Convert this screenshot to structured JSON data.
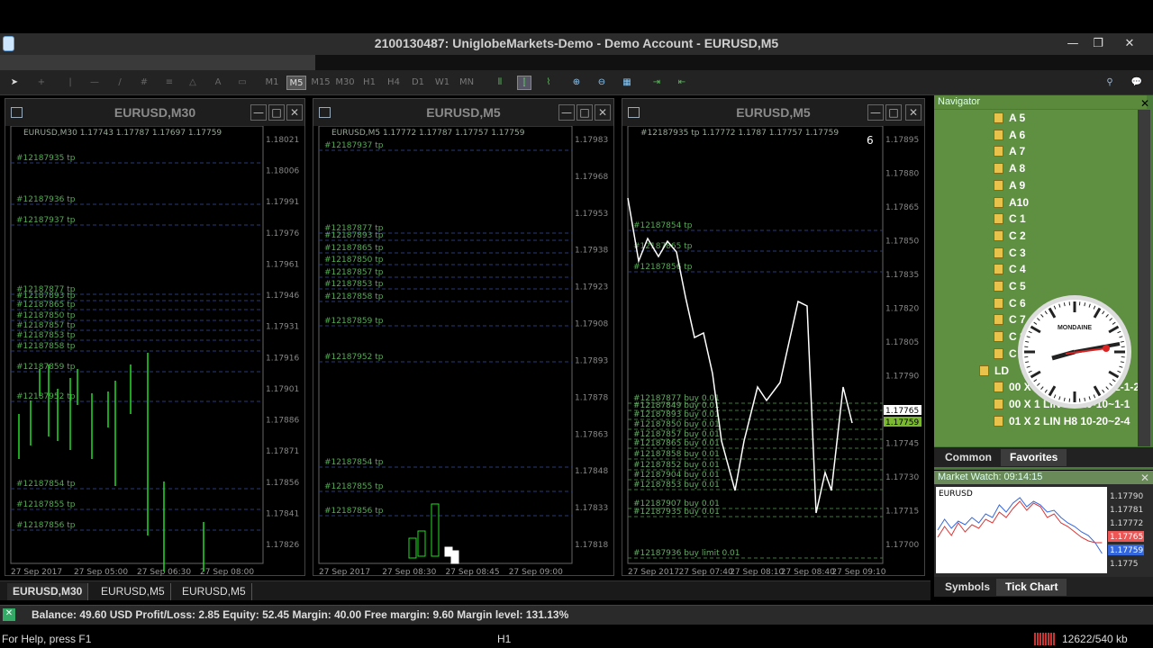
{
  "window": {
    "title": "2100130487: UniglobeMarkets-Demo - Demo Account - EURUSD,M5",
    "minimize": "—",
    "restore": "❐",
    "close": "✕"
  },
  "toolbar": {
    "timeframes": [
      "M1",
      "M5",
      "M15",
      "M30",
      "H1",
      "H4",
      "D1",
      "W1",
      "MN"
    ],
    "active_timeframe": "M5"
  },
  "charts": [
    {
      "title": "EURUSD,M30",
      "header": "EURUSD,M30  1.17743 1.17787 1.17697 1.17759",
      "prices": [
        "1.18021",
        "1.18006",
        "1.17991",
        "1.17976",
        "1.17961",
        "1.17946",
        "1.17931",
        "1.17916",
        "1.17901",
        "1.17886",
        "1.17871",
        "1.17856",
        "1.17841",
        "1.17826"
      ],
      "times": [
        "27 Sep 2017",
        "27 Sep 05:00",
        "27 Sep 06:30",
        "27 Sep 08:00"
      ],
      "orders": [
        "#12187935 tp",
        "#12187936 tp",
        "#12187937 tp",
        "#12187877 tp",
        "#12187893 tp",
        "#12187865 tp",
        "#12187850 tp",
        "#12187857 tp",
        "#12187853 tp",
        "#12187858 tp",
        "#12187859 tp",
        "#12187952 tp",
        "#12187854 tp",
        "#12187855 tp",
        "#12187856 tp"
      ]
    },
    {
      "title": "EURUSD,M5",
      "header": "EURUSD,M5  1.17772 1.17787 1.17757 1.17759",
      "prices": [
        "1.17983",
        "1.17968",
        "1.17953",
        "1.17938",
        "1.17923",
        "1.17908",
        "1.17893",
        "1.17878",
        "1.17863",
        "1.17848",
        "1.17833",
        "1.17818"
      ],
      "times": [
        "27 Sep 2017",
        "27 Sep 08:30",
        "27 Sep 08:45",
        "27 Sep 09:00"
      ],
      "orders": [
        "#12187937 tp",
        "#12187877 tp",
        "#12187893 tp",
        "#12187865 tp",
        "#12187850 tp",
        "#12187857 tp",
        "#12187853 tp",
        "#12187858 tp",
        "#12187859 tp",
        "#12187952 tp",
        "#12187854 tp",
        "#12187855 tp",
        "#12187856 tp"
      ]
    },
    {
      "title": "EURUSD,M5",
      "header": "#12187935 tp  1.17772 1.1787 1.17757 1.17759",
      "prices": [
        "1.17895",
        "1.17880",
        "1.17865",
        "1.17850",
        "1.17835",
        "1.17820",
        "1.17805",
        "1.17790",
        "1.17775",
        "1.17745",
        "1.17730",
        "1.17715",
        "1.17700"
      ],
      "bid": "1.17765",
      "ask": "1.17759",
      "marker": "6",
      "times": [
        "27 Sep 2017",
        "27 Sep 07:40",
        "27 Sep 08:10",
        "27 Sep 08:40",
        "27 Sep 09:10"
      ],
      "orders": [
        "#12187854 tp",
        "#12187865 tp",
        "#12187856 tp",
        "#12187877 buy 0.01",
        "#12187849 buy 0.01",
        "#12187893 buy 0.01",
        "#12187850 buy 0.01",
        "#12187857 buy 0.01",
        "#12187865 buy 0.01",
        "#12187858 buy 0.01",
        "#12187852 buy 0.01",
        "#12187904 buy 0.01",
        "#12187853 buy 0.01",
        "#12187907 buy 0.01",
        "#12187935 buy 0.01",
        "#12187936 buy limit 0.01"
      ]
    }
  ],
  "chart_tabs": [
    "EURUSD,M30",
    "EURUSD,M5",
    "EURUSD,M5"
  ],
  "navigator": {
    "title": "Navigator",
    "items": [
      "A 5",
      "A 6",
      "A 7",
      "A 8",
      "A 9",
      "A10",
      "C 1",
      "C 2",
      "C 3",
      "C 4",
      "C 5",
      "C 6",
      "C 7",
      "C 8",
      "C 9",
      "LD",
      "00 X 1 LIN H8 20-10~2-1-2",
      "00 X 1 LIN H8 20-10~1-1",
      "01 X 2 LIN H8 10-20~2-4"
    ],
    "tabs": [
      "Common",
      "Favorites"
    ],
    "active_tab": "Favorites"
  },
  "clock": {
    "brand": "MONDAINE"
  },
  "market_watch": {
    "title": "Market Watch: 09:14:15",
    "symbol": "EURUSD",
    "prices": [
      "1.17790",
      "1.17781",
      "1.17772",
      "1.17765",
      "1.17759",
      "1.1775"
    ],
    "tabs": [
      "Symbols",
      "Tick Chart"
    ],
    "active_tab": "Tick Chart",
    "tick_series": [
      {
        "name": "bid",
        "values": [
          1.17768,
          1.17774,
          1.17769,
          1.17776,
          1.17771,
          1.17775,
          1.17773,
          1.17778,
          1.17776,
          1.17782,
          1.17779,
          1.17784,
          1.17788,
          1.17783,
          1.17787,
          1.17785,
          1.17779,
          1.17781,
          1.17776,
          1.17774,
          1.17771,
          1.17768,
          1.17766,
          1.17765,
          1.17765
        ]
      },
      {
        "name": "ask",
        "values": [
          1.17772,
          1.17778,
          1.17773,
          1.17777,
          1.17775,
          1.17779,
          1.17776,
          1.17781,
          1.17779,
          1.17786,
          1.17782,
          1.17787,
          1.1779,
          1.17785,
          1.17788,
          1.17786,
          1.17782,
          1.17783,
          1.17779,
          1.17776,
          1.17774,
          1.17771,
          1.17769,
          1.17765,
          1.17759
        ]
      }
    ]
  },
  "status": {
    "account": "Balance: 49.60 USD  Profit/Loss: 2.85  Equity: 52.45  Margin: 40.00  Free margin: 9.60  Margin level: 131.13%"
  },
  "footer": {
    "help": "For Help, press F1",
    "timeframe": "H1",
    "traffic": "12622/540 kb"
  },
  "colors": {
    "candle": "#22dd22",
    "line": "#ffffff",
    "grid": "#2a3a7a",
    "nav_bg": "#5f8f40",
    "accent": "#4a7a3a"
  }
}
